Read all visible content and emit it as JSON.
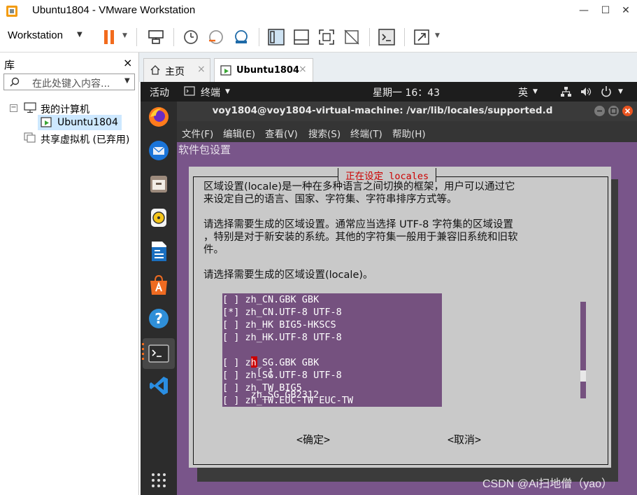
{
  "window": {
    "title": "Ubuntu1804 - VMware Workstation",
    "minimize": "—",
    "maximize": "☐",
    "close": "✕"
  },
  "toolbar": {
    "workstation_menu": "Workstation"
  },
  "library": {
    "title": "库",
    "close": "×",
    "search_placeholder": "在此处键入内容...",
    "tree": {
      "my_computer": "我的计算机",
      "vm": "Ubuntu1804",
      "shared": "共享虚拟机 (已弃用)"
    }
  },
  "tabs": [
    {
      "label": "主页",
      "close": "×"
    },
    {
      "label": "Ubuntu1804",
      "close": "×"
    }
  ],
  "gnome": {
    "activities": "活动",
    "terminal_app": "终端",
    "clock": "星期一 16：43",
    "input_method": "英"
  },
  "terminal": {
    "title": "voy1804@voy1804-virtual-machine: /var/lib/locales/supported.d",
    "menu": [
      "文件(F)",
      "编辑(E)",
      "查看(V)",
      "搜索(S)",
      "终端(T)",
      "帮助(H)"
    ],
    "backtitle": "软件包设置"
  },
  "dialog": {
    "title": " 正在设定 locales ",
    "paragraph1_line1": "区域设置(locale)是一种在多种语言之间切换的框架，用户可以通过它",
    "paragraph1_line2": "来设定自己的语言、国家、字符集、字符串排序方式等。",
    "paragraph2_line1": "请选择需要生成的区域设置。通常应当选择 UTF-8 字符集的区域设置",
    "paragraph2_line2": "，特别是对于新安装的系统。其他的字符集一般用于兼容旧系统和旧软",
    "paragraph2_line3": "件。",
    "paragraph3": "请选择需要生成的区域设置(locale)。",
    "ok_button": "<确定>",
    "cancel_button": "<取消>",
    "locales": [
      {
        "mark": "[ ]",
        "name": "zh_CN.GBK GBK",
        "checked": false
      },
      {
        "mark": "[*]",
        "name": "zh_CN.UTF-8 UTF-8",
        "checked": true
      },
      {
        "mark": "[ ]",
        "name": "zh_HK BIG5-HKSCS",
        "checked": false
      },
      {
        "mark": "[ ]",
        "name": "zh_HK.UTF-8 UTF-8",
        "checked": false
      },
      {
        "mark": "[ ]",
        "name": "zh_SG GB2312",
        "checked": false,
        "cursor": true
      },
      {
        "mark": "[ ]",
        "name": "zh_SG.GBK GBK",
        "checked": false
      },
      {
        "mark": "[ ]",
        "name": "zh_SG.UTF-8 UTF-8",
        "checked": false
      },
      {
        "mark": "[ ]",
        "name": "zh_TW BIG5",
        "checked": false
      },
      {
        "mark": "[ ]",
        "name": "zh_TW.EUC-TW EUC-TW",
        "checked": false
      }
    ]
  },
  "watermark": "CSDN @Ai扫地僧（yao）",
  "colors": {
    "terminal_bg": "#79558a",
    "dialog_bg": "#c9c9c9",
    "dialog_title": "#cc0000",
    "cursor": "#cc0000",
    "accent_orange": "#f26b1d"
  }
}
